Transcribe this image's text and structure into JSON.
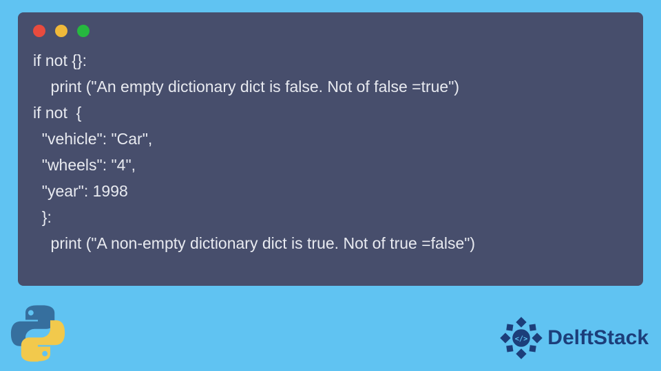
{
  "code": {
    "lines": [
      "if not {}:",
      "    print (\"An empty dictionary dict is false. Not of false =true\")",
      "if not  {",
      "  \"vehicle\": \"Car\",",
      "  \"wheels\": \"4\",",
      "  \"year\": 1998",
      "  }:",
      "    print (\"A non-empty dictionary dict is true. Not of true =false\")"
    ]
  },
  "window": {
    "dot_colors": {
      "red": "#e84b3e",
      "yellow": "#f0b93a",
      "green": "#26b83f"
    }
  },
  "brand": {
    "name": "DelftStack"
  },
  "footer_icons": {
    "left": "python-logo",
    "right": "delftstack-logo"
  }
}
